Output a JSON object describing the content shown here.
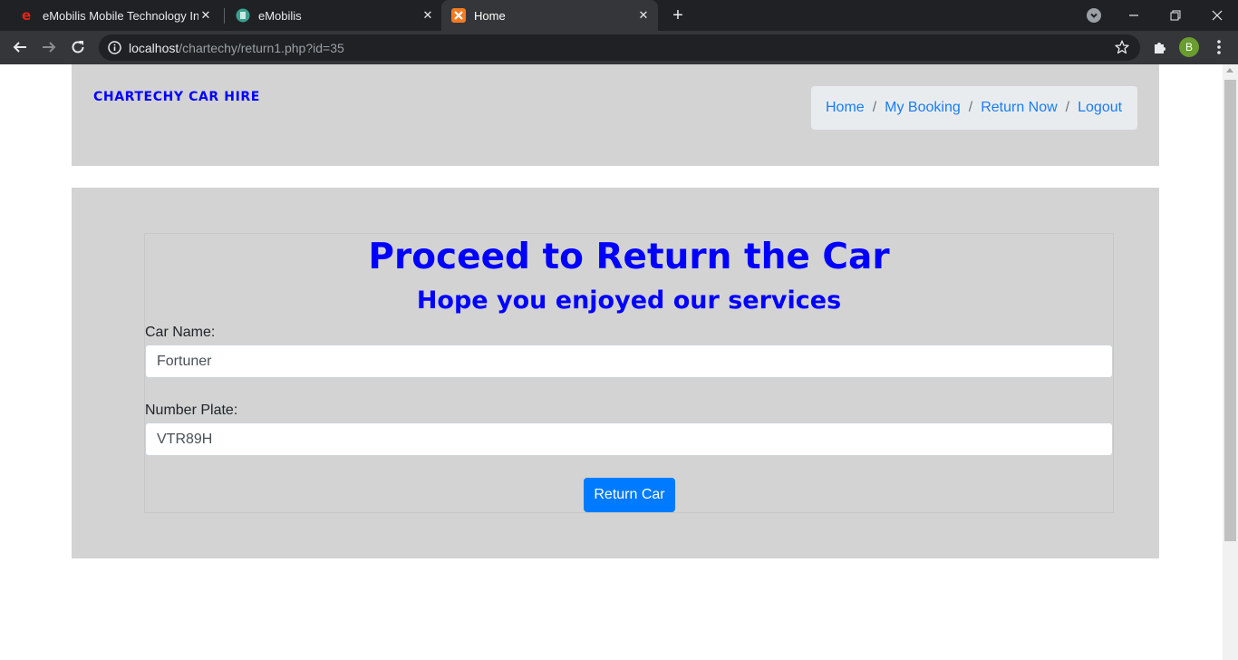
{
  "browser": {
    "tabs": [
      {
        "title": "eMobilis Mobile Technology Instit",
        "favicon": "emobilis-e-icon",
        "active": false
      },
      {
        "title": "eMobilis",
        "favicon": "emobilis-globe-icon",
        "active": false
      },
      {
        "title": "Home",
        "favicon": "xampp-icon",
        "active": true
      }
    ],
    "url_host": "localhost",
    "url_path": "/chartechy/return1.php?id=35",
    "profile_initial": "B",
    "colors": {
      "tabbar": "#202124",
      "toolbar": "#35363a",
      "avatar": "#6a9c2f"
    }
  },
  "header": {
    "brand": "CHARTECHY CAR HIRE",
    "nav": [
      "Home",
      "My Booking",
      "Return Now",
      "Logout"
    ],
    "separator": "/"
  },
  "form": {
    "title": "Proceed to Return the Car",
    "subtitle": "Hope you enjoyed our services",
    "car_name_label": "Car Name:",
    "car_name_value": "Fortuner",
    "plate_label": "Number Plate:",
    "plate_value": "VTR89H",
    "submit_label": "Return Car"
  },
  "colors": {
    "accent": "#0000ff",
    "link": "#1a7df2",
    "button": "#007bff",
    "panel": "#d3d3d3"
  }
}
